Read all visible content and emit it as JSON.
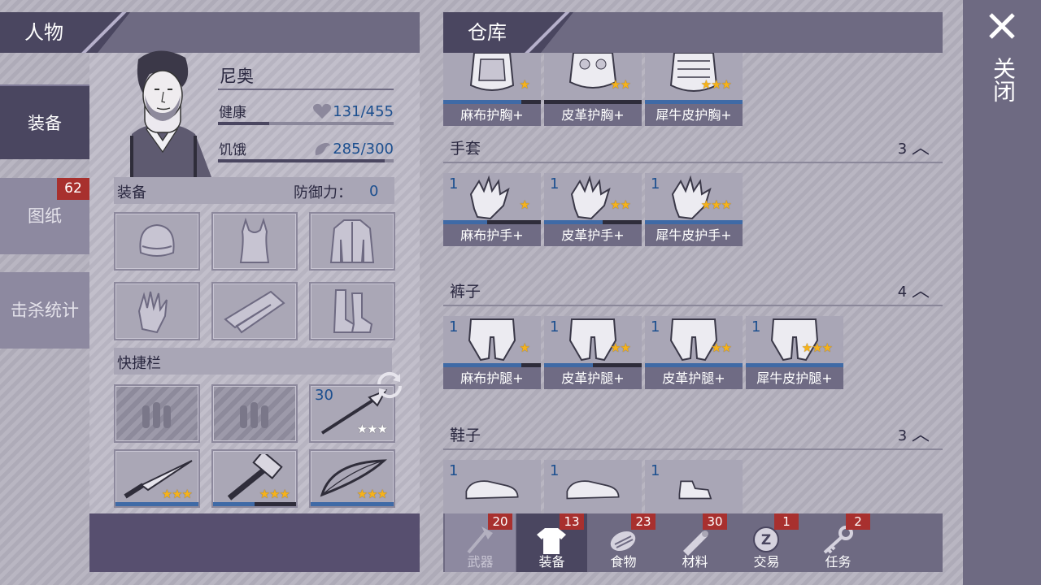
{
  "left_header": {
    "title": "人物"
  },
  "right_header": {
    "title": "仓库"
  },
  "close": {
    "label": "关闭"
  },
  "side_tabs": [
    {
      "label": "装备"
    },
    {
      "label": "图纸",
      "badge": "62"
    },
    {
      "label": "击杀统计"
    }
  ],
  "character": {
    "name": "尼奥",
    "health_label": "健康",
    "health_value": "131/455",
    "health_fraction": 0.29,
    "hunger_label": "饥饿",
    "hunger_value": "285/300",
    "hunger_fraction": 0.95
  },
  "equipment": {
    "title": "装备",
    "defense_label": "防御力：",
    "defense_value": "0",
    "slots": [
      {
        "icon": "helmet-icon"
      },
      {
        "icon": "vest-icon"
      },
      {
        "icon": "jacket-icon"
      },
      {
        "icon": "gloves-icon"
      },
      {
        "icon": "pants-icon"
      },
      {
        "icon": "boots-icon"
      }
    ]
  },
  "quickbar": {
    "title": "快捷栏",
    "spear_count": "30",
    "slots": [
      {
        "icon": "ammo-icon",
        "locked": true
      },
      {
        "icon": "ammo-icon",
        "locked": true
      },
      {
        "icon": "spear-icon",
        "stars": "★★★",
        "count": "30"
      },
      {
        "icon": "knife-icon",
        "stars": "★★★",
        "durability": 1.0
      },
      {
        "icon": "hammer-icon",
        "stars": "★★★",
        "durability": 0.5
      },
      {
        "icon": "bow-icon",
        "stars": "★★★",
        "durability": 1.0
      }
    ]
  },
  "warehouse": {
    "chest": {
      "items": [
        {
          "name": "麻布护胸+",
          "stars": "★",
          "durability": 0.8
        },
        {
          "name": "皮革护胸+",
          "stars": "★★",
          "durability": 0.0
        },
        {
          "name": "犀牛皮护胸+",
          "stars": "★★★",
          "durability": 1.0
        }
      ]
    },
    "gloves": {
      "label": "手套",
      "count": "3",
      "items": [
        {
          "count": "1",
          "name": "麻布护手+",
          "stars": "★",
          "durability": 0.45
        },
        {
          "count": "1",
          "name": "皮革护手+",
          "stars": "★★",
          "durability": 0.6
        },
        {
          "count": "1",
          "name": "犀牛皮护手+",
          "stars": "★★★",
          "durability": 1.0
        }
      ]
    },
    "pants": {
      "label": "裤子",
      "count": "4",
      "items": [
        {
          "count": "1",
          "name": "麻布护腿+",
          "stars": "★",
          "durability": 0.8
        },
        {
          "count": "1",
          "name": "皮革护腿+",
          "stars": "★★",
          "durability": 0.5
        },
        {
          "count": "1",
          "name": "皮革护腿+",
          "stars": "★★",
          "durability": 1.0
        },
        {
          "count": "1",
          "name": "犀牛皮护腿+",
          "stars": "★★★",
          "durability": 1.0
        }
      ]
    },
    "shoes": {
      "label": "鞋子",
      "count": "3",
      "items": [
        {
          "count": "1"
        },
        {
          "count": "1"
        },
        {
          "count": "1"
        }
      ]
    }
  },
  "bottom_tabs": [
    {
      "label": "武器",
      "badge": "20",
      "icon": "axe-icon"
    },
    {
      "label": "装备",
      "badge": "13",
      "icon": "shirt-icon"
    },
    {
      "label": "食物",
      "badge": "23",
      "icon": "food-icon"
    },
    {
      "label": "材料",
      "badge": "30",
      "icon": "log-icon"
    },
    {
      "label": "交易",
      "badge": "1",
      "icon": "coin-icon"
    },
    {
      "label": "任务",
      "badge": "2",
      "icon": "key-icon"
    }
  ],
  "colors": {
    "accent": "#4a4660",
    "badge": "#a8302e",
    "durability": "#3f6aa6",
    "star": "#f6b21a"
  }
}
